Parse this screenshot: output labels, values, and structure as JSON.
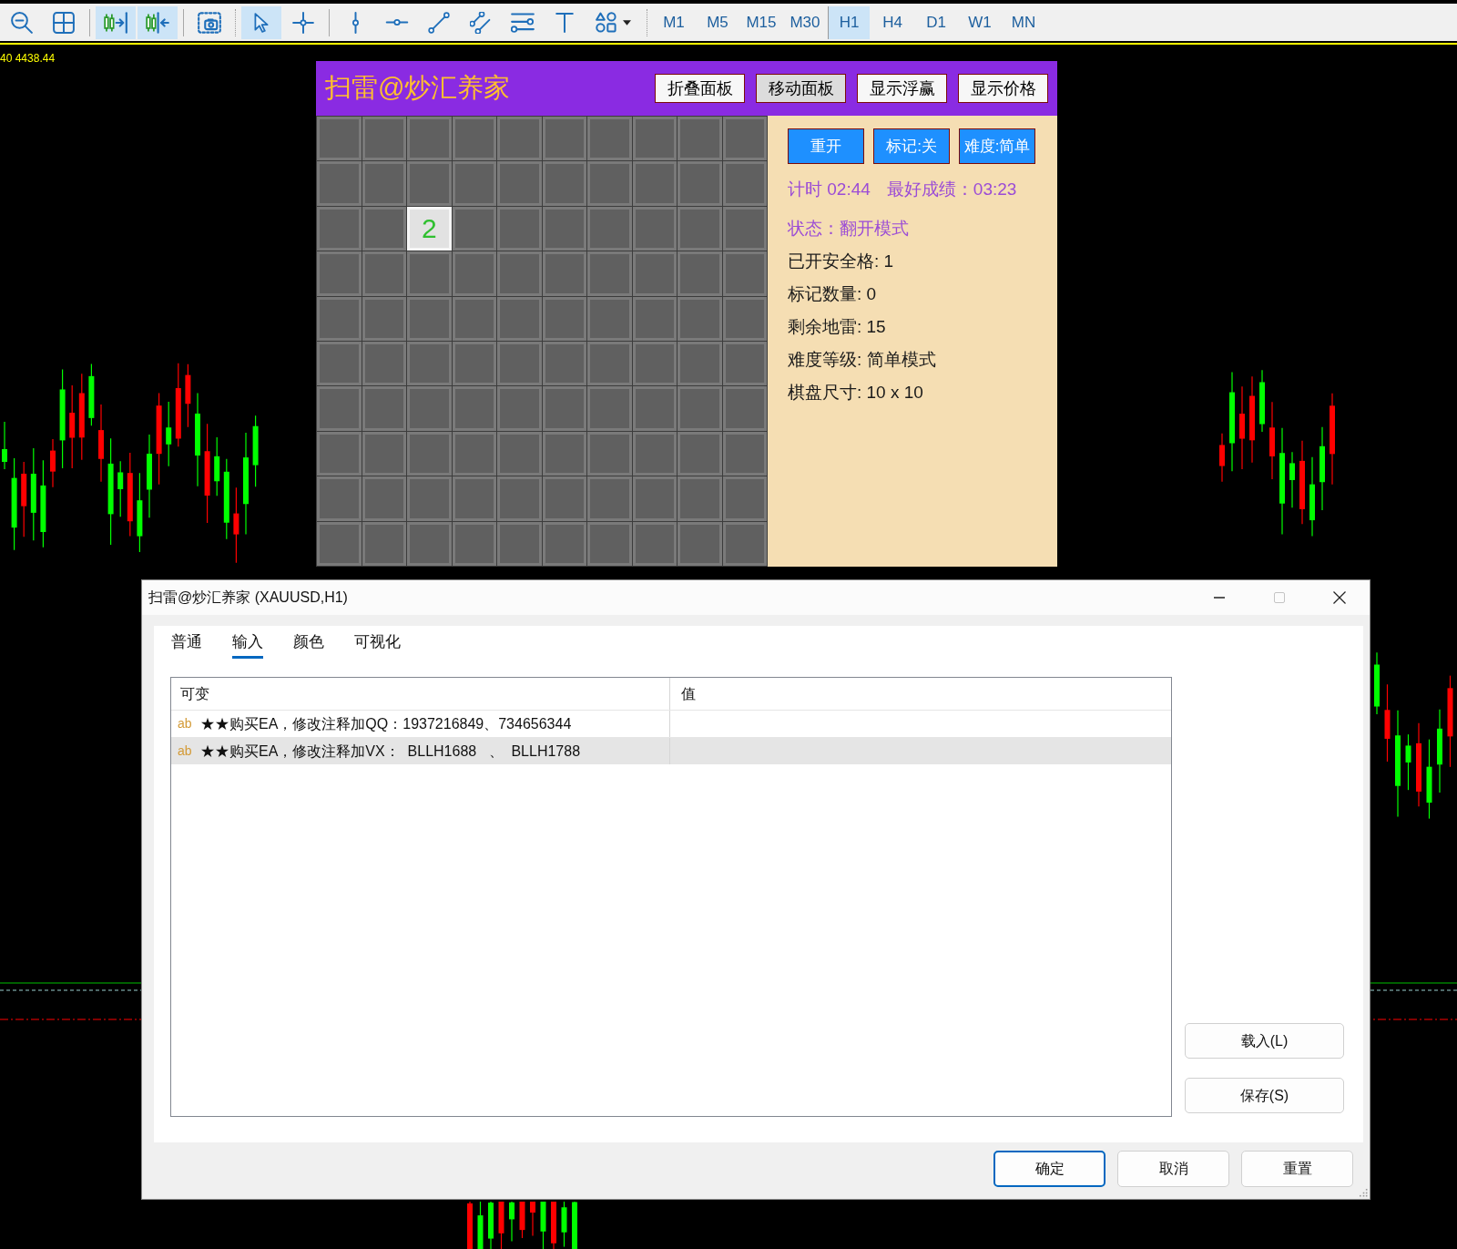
{
  "toolbar": {
    "tools": [
      {
        "kind": "zoom_out",
        "on": false
      },
      {
        "kind": "grid",
        "on": false
      },
      {
        "kind": "chart_shift",
        "on": true
      },
      {
        "kind": "autoscroll",
        "on": true
      },
      {
        "kind": "screenshot",
        "on": false
      },
      {
        "kind": "cursor",
        "on": true
      },
      {
        "kind": "crosshair",
        "on": false
      },
      {
        "kind": "vertical_line",
        "on": false
      },
      {
        "kind": "horizontal_line",
        "on": false
      },
      {
        "kind": "trend_line",
        "on": false
      },
      {
        "kind": "channel",
        "on": false
      },
      {
        "kind": "fibonacci",
        "on": false
      },
      {
        "kind": "text",
        "on": false
      },
      {
        "kind": "shapes",
        "on": false
      }
    ],
    "timeframes": [
      {
        "label": "M1",
        "selected": false
      },
      {
        "label": "M5",
        "selected": false
      },
      {
        "label": "M15",
        "selected": false
      },
      {
        "label": "M30",
        "selected": false
      },
      {
        "label": "H1",
        "selected": true
      },
      {
        "label": "H4",
        "selected": false
      },
      {
        "label": "D1",
        "selected": false
      },
      {
        "label": "W1",
        "selected": false
      },
      {
        "label": "MN",
        "selected": false
      }
    ]
  },
  "chart": {
    "price_label": "40 4438.44"
  },
  "game_panel": {
    "title": "扫雷@炒汇养家",
    "header_buttons": [
      {
        "label": "折叠面板",
        "pressed": false
      },
      {
        "label": "移动面板",
        "pressed": true
      },
      {
        "label": "显示浮赢",
        "pressed": false
      },
      {
        "label": "显示价格",
        "pressed": false
      }
    ],
    "board": [
      [
        {
          "revealed": false
        },
        {
          "revealed": false
        },
        {
          "revealed": false
        },
        {
          "revealed": false
        },
        {
          "revealed": false
        },
        {
          "revealed": false
        },
        {
          "revealed": false
        },
        {
          "revealed": false
        },
        {
          "revealed": false
        },
        {
          "revealed": false
        }
      ],
      [
        {
          "revealed": false
        },
        {
          "revealed": false
        },
        {
          "revealed": false
        },
        {
          "revealed": false
        },
        {
          "revealed": false
        },
        {
          "revealed": false
        },
        {
          "revealed": false
        },
        {
          "revealed": false
        },
        {
          "revealed": false
        },
        {
          "revealed": false
        }
      ],
      [
        {
          "revealed": false
        },
        {
          "revealed": false
        },
        {
          "revealed": true,
          "number": "2"
        },
        {
          "revealed": false
        },
        {
          "revealed": false
        },
        {
          "revealed": false
        },
        {
          "revealed": false
        },
        {
          "revealed": false
        },
        {
          "revealed": false
        },
        {
          "revealed": false
        }
      ],
      [
        {
          "revealed": false
        },
        {
          "revealed": false
        },
        {
          "revealed": false
        },
        {
          "revealed": false
        },
        {
          "revealed": false
        },
        {
          "revealed": false
        },
        {
          "revealed": false
        },
        {
          "revealed": false
        },
        {
          "revealed": false
        },
        {
          "revealed": false
        }
      ],
      [
        {
          "revealed": false
        },
        {
          "revealed": false
        },
        {
          "revealed": false
        },
        {
          "revealed": false
        },
        {
          "revealed": false
        },
        {
          "revealed": false
        },
        {
          "revealed": false
        },
        {
          "revealed": false
        },
        {
          "revealed": false
        },
        {
          "revealed": false
        }
      ],
      [
        {
          "revealed": false
        },
        {
          "revealed": false
        },
        {
          "revealed": false
        },
        {
          "revealed": false
        },
        {
          "revealed": false
        },
        {
          "revealed": false
        },
        {
          "revealed": false
        },
        {
          "revealed": false
        },
        {
          "revealed": false
        },
        {
          "revealed": false
        }
      ],
      [
        {
          "revealed": false
        },
        {
          "revealed": false
        },
        {
          "revealed": false
        },
        {
          "revealed": false
        },
        {
          "revealed": false
        },
        {
          "revealed": false
        },
        {
          "revealed": false
        },
        {
          "revealed": false
        },
        {
          "revealed": false
        },
        {
          "revealed": false
        }
      ],
      [
        {
          "revealed": false
        },
        {
          "revealed": false
        },
        {
          "revealed": false
        },
        {
          "revealed": false
        },
        {
          "revealed": false
        },
        {
          "revealed": false
        },
        {
          "revealed": false
        },
        {
          "revealed": false
        },
        {
          "revealed": false
        },
        {
          "revealed": false
        }
      ],
      [
        {
          "revealed": false
        },
        {
          "revealed": false
        },
        {
          "revealed": false
        },
        {
          "revealed": false
        },
        {
          "revealed": false
        },
        {
          "revealed": false
        },
        {
          "revealed": false
        },
        {
          "revealed": false
        },
        {
          "revealed": false
        },
        {
          "revealed": false
        }
      ],
      [
        {
          "revealed": false
        },
        {
          "revealed": false
        },
        {
          "revealed": false
        },
        {
          "revealed": false
        },
        {
          "revealed": false
        },
        {
          "revealed": false
        },
        {
          "revealed": false
        },
        {
          "revealed": false
        },
        {
          "revealed": false
        },
        {
          "revealed": false
        }
      ]
    ],
    "controls": [
      "重开",
      "标记:关",
      "难度:简单"
    ],
    "timer": "计时 02:44",
    "best": "最好成绩：03:23",
    "status": "状态：翻开模式",
    "info": [
      "已开安全格: 1",
      "标记数量: 0",
      "剩余地雷: 15",
      "难度等级: 简单模式",
      "棋盘尺寸: 10 x 10"
    ]
  },
  "dialog": {
    "title": "扫雷@炒汇养家 (XAUUSD,H1)",
    "window_buttons": [
      {
        "kind": "minimize",
        "disabled": false
      },
      {
        "kind": "maximize",
        "disabled": true
      },
      {
        "kind": "close",
        "disabled": false
      }
    ],
    "tabs": [
      {
        "label": "普通",
        "selected": false
      },
      {
        "label": "输入",
        "selected": true
      },
      {
        "label": "颜色",
        "selected": false
      },
      {
        "label": "可视化",
        "selected": false
      }
    ],
    "table": {
      "columns": [
        "可变",
        "值"
      ],
      "rows": [
        {
          "badge": "ab",
          "name": "★★购买EA，修改注释加QQ：1937216849、734656344",
          "selected": false
        },
        {
          "badge": "ab",
          "name": "★★购买EA，修改注释加VX：  BLLH1688   、  BLLH1788",
          "selected": true
        }
      ]
    },
    "side_buttons": [
      "载入(L)",
      "保存(S)"
    ],
    "buttons": [
      {
        "label": "确定",
        "default": true
      },
      {
        "label": "取消",
        "default": false
      },
      {
        "label": "重置",
        "default": false
      }
    ]
  }
}
